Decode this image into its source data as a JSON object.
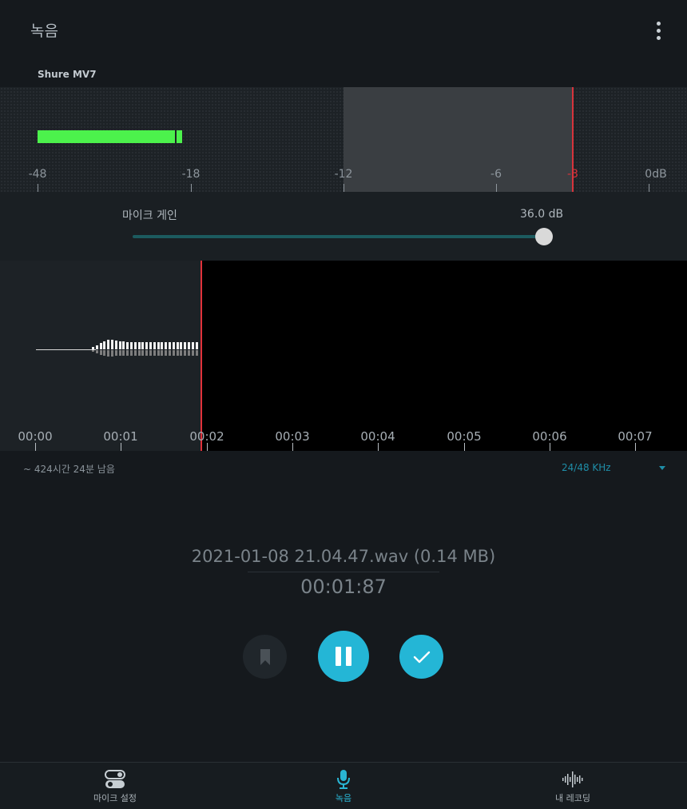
{
  "header": {
    "title": "녹음",
    "menu_icon": "more-vert-icon"
  },
  "device": {
    "name": "Shure MV7"
  },
  "meter": {
    "scale_labels": [
      "-48",
      "-18",
      "-12",
      "-6",
      "-3",
      "0dB"
    ],
    "level_db": -19,
    "peak_db": -18,
    "clip_db": -3,
    "colors": {
      "level": "#4cf24c",
      "clip": "#d7333b"
    }
  },
  "gain": {
    "label": "마이크 게인",
    "value": "36.0 dB",
    "fraction": 0.99
  },
  "waveform": {
    "time_labels": [
      "00:00",
      "00:01",
      "00:02",
      "00:03",
      "00:04",
      "00:05",
      "00:06",
      "00:07"
    ],
    "playhead_seconds": 1.87
  },
  "status": {
    "remaining": "~ 424시간 24분 남음",
    "sample_rate": "24/48 KHz"
  },
  "recording": {
    "file": "2021-01-08 21.04.47.wav (0.14 MB)",
    "elapsed": "00:01:87"
  },
  "controls": {
    "bookmark_icon": "bookmark-icon",
    "pause_icon": "pause-icon",
    "finish_icon": "check-icon",
    "accent": "#24b6d6"
  },
  "nav": {
    "items": [
      {
        "label": "마이크 설정",
        "icon": "toggle-icon"
      },
      {
        "label": "녹음",
        "icon": "mic-icon"
      },
      {
        "label": "내 레코딩",
        "icon": "waveform-icon"
      }
    ]
  }
}
